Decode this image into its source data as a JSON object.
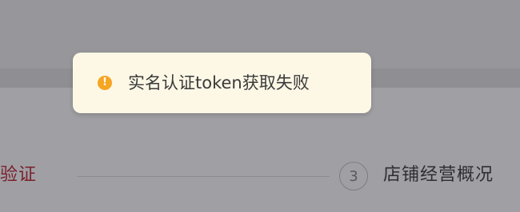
{
  "toast": {
    "message": "实名认证token获取失败",
    "icon": "warning-icon",
    "icon_glyph": "!",
    "icon_color": "#f5a623",
    "background": "#fdf8e6"
  },
  "steps": {
    "current_label": "验证",
    "current_color": "#7a1f2b",
    "next_number": "3",
    "next_label": "店铺经营概况"
  }
}
